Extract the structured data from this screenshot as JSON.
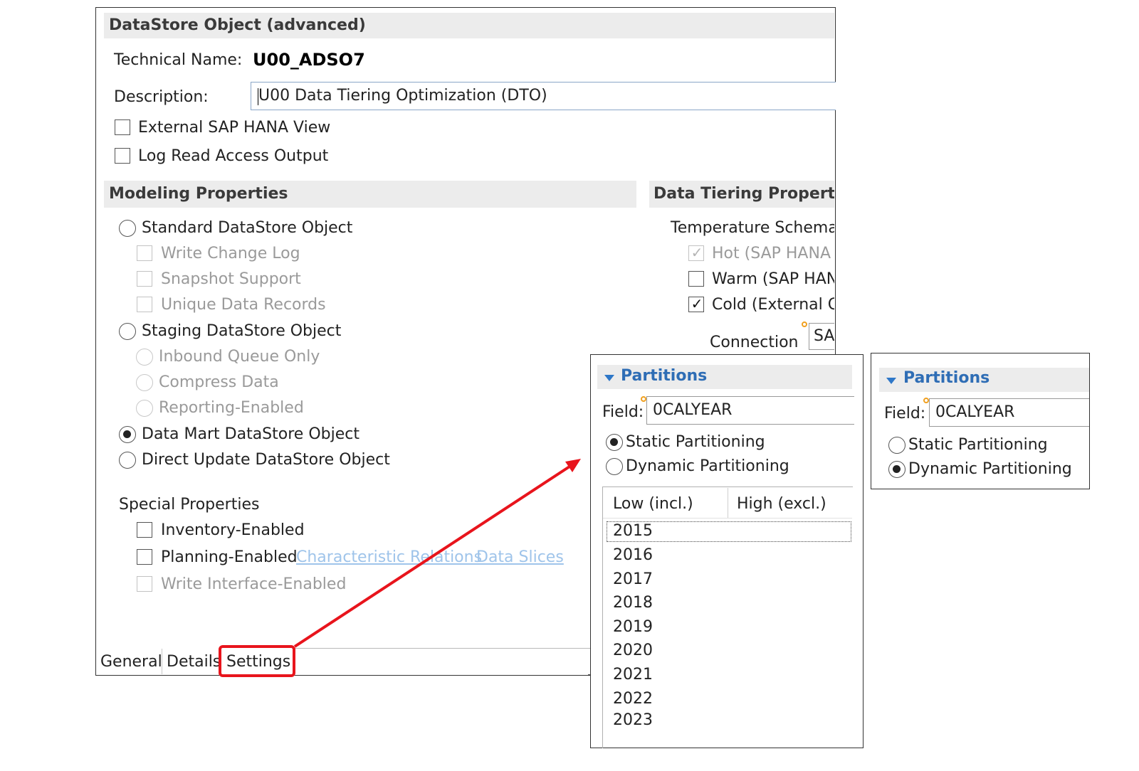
{
  "editor": {
    "title": "DataStore Object (advanced)",
    "technical_name_label": "Technical Name:",
    "technical_name_value": "U00_ADSO7",
    "description_label": "Description:",
    "description_value": "U00 Data Tiering Optimization (DTO)",
    "external_hana_view": "External SAP HANA View",
    "log_read_access": "Log Read Access Output"
  },
  "modeling": {
    "header": "Modeling Properties",
    "standard_dso": "Standard DataStore Object",
    "write_change_log": "Write Change Log",
    "snapshot_support": "Snapshot Support",
    "unique_data_records": "Unique Data Records",
    "staging_dso": "Staging DataStore Object",
    "inbound_queue_only": "Inbound Queue Only",
    "compress_data": "Compress Data",
    "reporting_enabled": "Reporting-Enabled",
    "data_mart_dso": "Data Mart DataStore Object",
    "direct_update_dso": "Direct Update DataStore Object",
    "selected": "Data Mart DataStore Object"
  },
  "special": {
    "header": "Special Properties",
    "inventory_enabled": "Inventory-Enabled",
    "planning_enabled": "Planning-Enabled",
    "characteristic_relations": "Characteristic Relations",
    "data_slices": "Data Slices",
    "write_interface_enabled": "Write Interface-Enabled"
  },
  "tiering": {
    "header": "Data Tiering Properties",
    "temperature_schema": "Temperature Schema",
    "hot": "Hot (SAP HANA",
    "warm": "Warm (SAP HAN",
    "cold": "Cold (External C",
    "connection_label": "Connection",
    "connection_value": "SA"
  },
  "tabs": [
    {
      "label": "General"
    },
    {
      "label": "Details"
    },
    {
      "label": "Settings"
    }
  ],
  "partitions_static": {
    "header": "Partitions",
    "field_label": "Field:",
    "field_value": "0CALYEAR",
    "static_label": "Static Partitioning",
    "dynamic_label": "Dynamic Partitioning",
    "selected": "Static Partitioning",
    "columns": [
      "Low (incl.)",
      "High (excl.)"
    ],
    "rows": [
      "2015",
      "2016",
      "2017",
      "2018",
      "2019",
      "2020",
      "2021",
      "2022",
      "2023"
    ]
  },
  "partitions_dynamic": {
    "header": "Partitions",
    "field_label": "Field:",
    "field_value": "0CALYEAR",
    "static_label": "Static Partitioning",
    "dynamic_label": "Dynamic Partitioning",
    "selected": "Dynamic Partitioning"
  },
  "colors": {
    "highlight": "#e8141c",
    "link": "#9fc4ea",
    "section_blue": "#2e6db5",
    "header_bg": "#ececec"
  }
}
